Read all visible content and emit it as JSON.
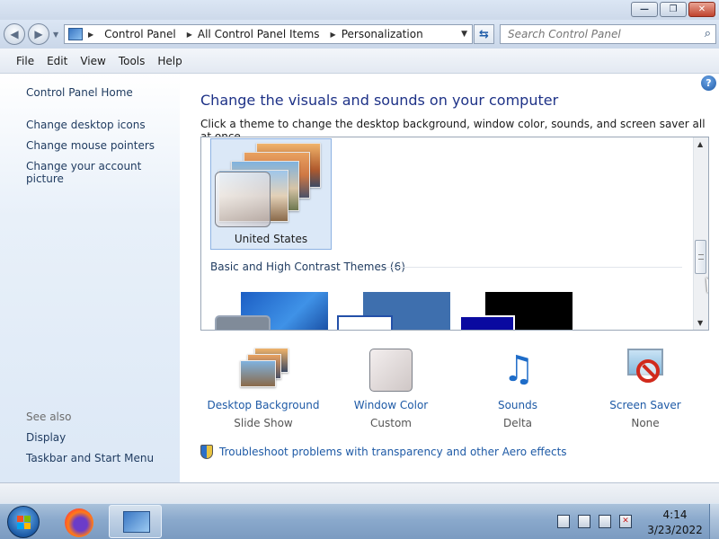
{
  "window": {
    "buttons": {
      "minimize": "—",
      "maximize": "❐",
      "close": "✕"
    }
  },
  "address": {
    "breadcrumbs": [
      "Control Panel",
      "All Control Panel Items",
      "Personalization"
    ],
    "search_placeholder": "Search Control Panel"
  },
  "menu": [
    "File",
    "Edit",
    "View",
    "Tools",
    "Help"
  ],
  "sidebar": {
    "home": "Control Panel Home",
    "links": [
      "Change desktop icons",
      "Change mouse pointers",
      "Change your account picture"
    ],
    "see_also_label": "See also",
    "see_also": [
      "Display",
      "Taskbar and Start Menu"
    ]
  },
  "main": {
    "heading": "Change the visuals and sounds on your computer",
    "subheading": "Click a theme to change the desktop background, window color, sounds, and screen saver all at once.",
    "selected_theme": "United States",
    "group_header": "Basic and High Contrast Themes (6)",
    "help_icon": "?"
  },
  "settings": [
    {
      "name": "Desktop Background",
      "value": "Slide Show",
      "icon": "desktop-background-icon"
    },
    {
      "name": "Window Color",
      "value": "Custom",
      "icon": "window-color-icon"
    },
    {
      "name": "Sounds",
      "value": "Delta",
      "icon": "sounds-icon"
    },
    {
      "name": "Screen Saver",
      "value": "None",
      "icon": "screen-saver-icon"
    }
  ],
  "troubleshoot": "Troubleshoot problems with transparency and other Aero effects",
  "taskbar": {
    "time": "4:14",
    "date": "3/23/2022"
  },
  "colors": {
    "accent_link": "#1e5aa6",
    "heading": "#1e3287",
    "taskbar": "#8aa9cc"
  }
}
